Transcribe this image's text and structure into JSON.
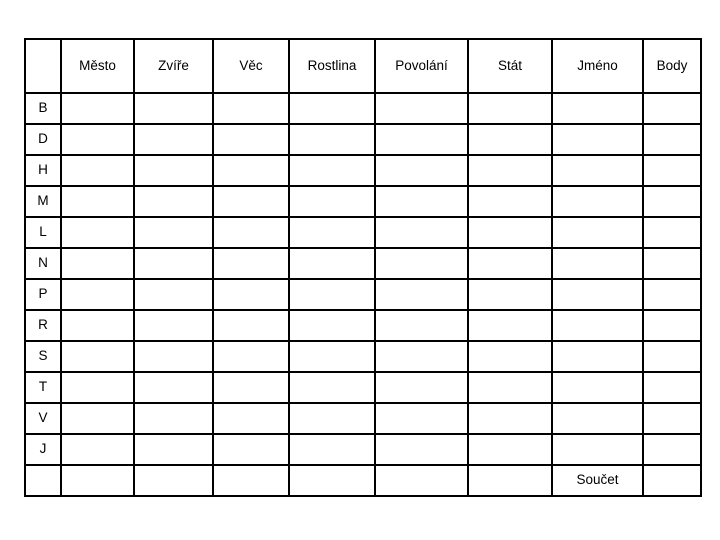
{
  "document": {
    "kind": "word-game-scorecard",
    "background_color": "#ffffff",
    "border_color": "#000000"
  },
  "table": {
    "columns": [
      {
        "key": "letter",
        "label": ""
      },
      {
        "key": "mesto",
        "label": "Město"
      },
      {
        "key": "zvire",
        "label": "Zvíře"
      },
      {
        "key": "vec",
        "label": "Věc"
      },
      {
        "key": "rostlina",
        "label": "Rostlina"
      },
      {
        "key": "povolani",
        "label": "Povolání"
      },
      {
        "key": "stat",
        "label": "Stát"
      },
      {
        "key": "jmeno",
        "label": "Jméno"
      },
      {
        "key": "body",
        "label": "Body"
      }
    ],
    "rows": [
      {
        "letter": "B",
        "mesto": "",
        "zvire": "",
        "vec": "",
        "rostlina": "",
        "povolani": "",
        "stat": "",
        "jmeno": "",
        "body": ""
      },
      {
        "letter": "D",
        "mesto": "",
        "zvire": "",
        "vec": "",
        "rostlina": "",
        "povolani": "",
        "stat": "",
        "jmeno": "",
        "body": ""
      },
      {
        "letter": "H",
        "mesto": "",
        "zvire": "",
        "vec": "",
        "rostlina": "",
        "povolani": "",
        "stat": "",
        "jmeno": "",
        "body": ""
      },
      {
        "letter": "M",
        "mesto": "",
        "zvire": "",
        "vec": "",
        "rostlina": "",
        "povolani": "",
        "stat": "",
        "jmeno": "",
        "body": ""
      },
      {
        "letter": "L",
        "mesto": "",
        "zvire": "",
        "vec": "",
        "rostlina": "",
        "povolani": "",
        "stat": "",
        "jmeno": "",
        "body": ""
      },
      {
        "letter": "N",
        "mesto": "",
        "zvire": "",
        "vec": "",
        "rostlina": "",
        "povolani": "",
        "stat": "",
        "jmeno": "",
        "body": ""
      },
      {
        "letter": "P",
        "mesto": "",
        "zvire": "",
        "vec": "",
        "rostlina": "",
        "povolani": "",
        "stat": "",
        "jmeno": "",
        "body": ""
      },
      {
        "letter": "R",
        "mesto": "",
        "zvire": "",
        "vec": "",
        "rostlina": "",
        "povolani": "",
        "stat": "",
        "jmeno": "",
        "body": ""
      },
      {
        "letter": "S",
        "mesto": "",
        "zvire": "",
        "vec": "",
        "rostlina": "",
        "povolani": "",
        "stat": "",
        "jmeno": "",
        "body": ""
      },
      {
        "letter": "T",
        "mesto": "",
        "zvire": "",
        "vec": "",
        "rostlina": "",
        "povolani": "",
        "stat": "",
        "jmeno": "",
        "body": ""
      },
      {
        "letter": "V",
        "mesto": "",
        "zvire": "",
        "vec": "",
        "rostlina": "",
        "povolani": "",
        "stat": "",
        "jmeno": "",
        "body": ""
      },
      {
        "letter": "J",
        "mesto": "",
        "zvire": "",
        "vec": "",
        "rostlina": "",
        "povolani": "",
        "stat": "",
        "jmeno": "",
        "body": ""
      }
    ],
    "footer_row": {
      "letter": "",
      "mesto": "",
      "zvire": "",
      "vec": "",
      "rostlina": "",
      "povolani": "",
      "stat": "",
      "jmeno": "Součet",
      "body": ""
    }
  }
}
